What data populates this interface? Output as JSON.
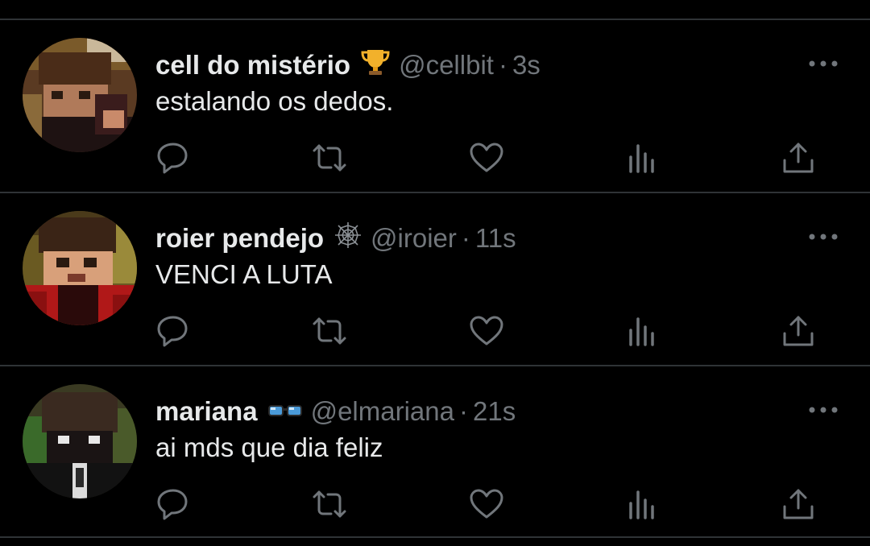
{
  "tweets": [
    {
      "display_name": "cell do mistério",
      "badge_emoji": "trophy-emoji",
      "handle": "@cellbit",
      "separator": "·",
      "time": "3s",
      "text": "estalando os dedos.",
      "avatar": "minecraft-skin-brown-hair-black-shirt"
    },
    {
      "display_name": "roier pendejo",
      "badge_emoji": "spider-web-emoji",
      "handle": "@iroier",
      "separator": "·",
      "time": "11s",
      "text": "VENCI A LUTA",
      "avatar": "minecraft-skin-red-shirt"
    },
    {
      "display_name": "mariana",
      "badge_emoji": "glasses-emoji",
      "handle": "@elmariana",
      "separator": "·",
      "time": "21s",
      "text": "ai mds que dia feliz",
      "avatar": "minecraft-skin-dark-suit"
    }
  ],
  "actions": [
    "reply-icon",
    "retweet-icon",
    "like-icon",
    "analytics-icon",
    "share-icon"
  ],
  "colors": {
    "background": "#000000",
    "text": "#e7e9ea",
    "muted": "#71767b",
    "divider": "#2f3336"
  }
}
